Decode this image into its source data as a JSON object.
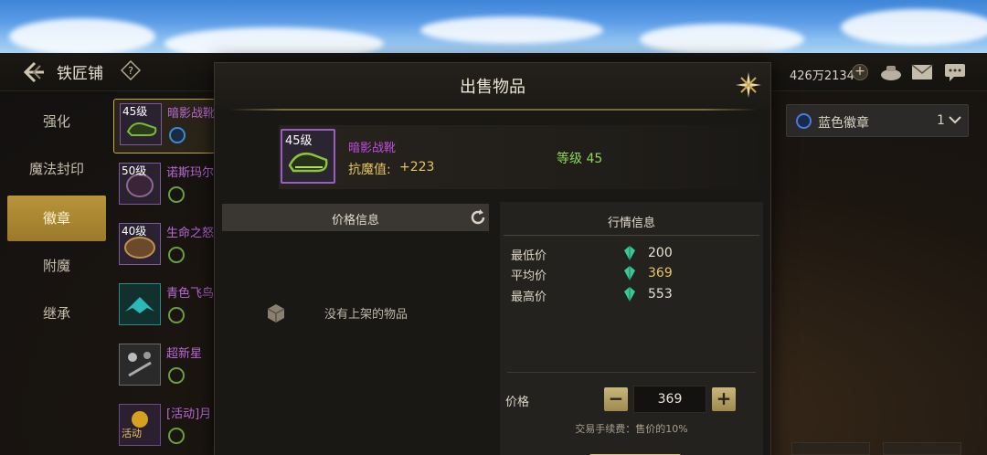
{
  "header": {
    "back_icon": "back-arrow-icon",
    "title": "铁匠铺",
    "help_icon": "question-icon",
    "gold": "426万2134",
    "gold_plus": "+",
    "icons": [
      "bag-icon",
      "mail-icon",
      "chat-icon"
    ]
  },
  "tabs": [
    {
      "label": "强化",
      "active": false
    },
    {
      "label": "魔法封印",
      "active": false
    },
    {
      "label": "徽章",
      "active": true
    },
    {
      "label": "附魔",
      "active": false
    },
    {
      "label": "继承",
      "active": false
    }
  ],
  "items": [
    {
      "level": "45级",
      "name": "暗影战靴"
    },
    {
      "level": "50级",
      "name": "诺斯玛尔"
    },
    {
      "level": "40级",
      "name": "生命之怒"
    },
    {
      "level": "",
      "name": "青色飞鸟"
    },
    {
      "level": "",
      "name": "超新星"
    },
    {
      "level": "",
      "name": "[活动]月",
      "badge": "活动"
    }
  ],
  "emblem_filter": {
    "label": "蓝色徽章",
    "count": "1"
  },
  "modal": {
    "title": "出售物品",
    "item": {
      "level": "45级",
      "name": "暗影战靴",
      "stat_label": "抗魔值:",
      "stat_value": "+223",
      "level_text": "等级 45"
    },
    "price_info": {
      "header": "价格信息",
      "empty_text": "没有上架的物品"
    },
    "market": {
      "title": "行情信息",
      "rows": [
        {
          "label": "最低价",
          "value": "200",
          "highlight": false
        },
        {
          "label": "平均价",
          "value": "369",
          "highlight": true
        },
        {
          "label": "最高价",
          "value": "553",
          "highlight": false
        }
      ],
      "price_label": "价格",
      "price_value": "369",
      "minus": "−",
      "plus": "+",
      "fee_text": "交易手续费：售价的10%"
    }
  }
}
